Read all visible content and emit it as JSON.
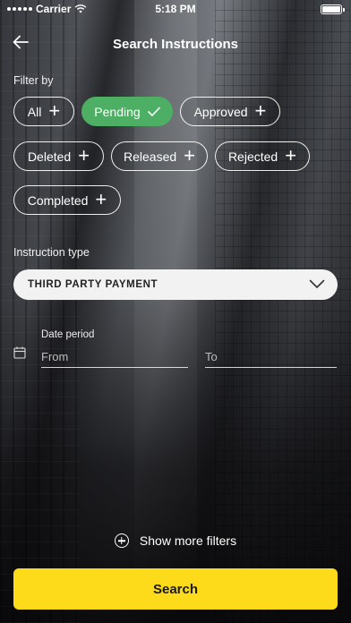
{
  "status_bar": {
    "carrier": "Carrier",
    "time": "5:18 PM"
  },
  "header": {
    "title": "Search Instructions",
    "back_icon": "arrow-left-icon"
  },
  "filter": {
    "label": "Filter by",
    "chips": [
      {
        "label": "All",
        "selected": false
      },
      {
        "label": "Pending",
        "selected": true
      },
      {
        "label": "Approved",
        "selected": false
      },
      {
        "label": "Deleted",
        "selected": false
      },
      {
        "label": "Released",
        "selected": false
      },
      {
        "label": "Rejected",
        "selected": false
      },
      {
        "label": "Completed",
        "selected": false
      }
    ]
  },
  "instruction_type": {
    "label": "Instruction type",
    "value": "THIRD PARTY PAYMENT"
  },
  "date_period": {
    "label": "Date period",
    "from_placeholder": "From",
    "to_placeholder": "To"
  },
  "more_filters": {
    "label": "Show more filters"
  },
  "search_button": {
    "label": "Search"
  },
  "colors": {
    "accent_yellow": "#fddb1a",
    "selected_green": "#4caf63"
  }
}
